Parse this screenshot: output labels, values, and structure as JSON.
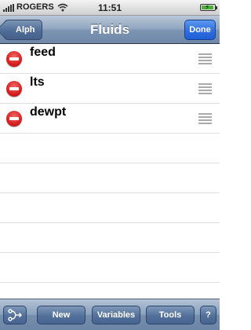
{
  "status_bar": {
    "carrier": "ROGERS",
    "time": "11:51"
  },
  "nav": {
    "back_label": "Alph",
    "title": "Fluids",
    "done_label": "Done"
  },
  "list": {
    "items": [
      {
        "label": "feed"
      },
      {
        "label": "lts"
      },
      {
        "label": "dewpt"
      }
    ]
  },
  "toolbar": {
    "branch_icon": "branch-icon",
    "new_label": "New",
    "variables_label": "Variables",
    "tools_label": "Tools",
    "help_label": "?"
  },
  "colors": {
    "nav_bar": "#8ea4bf",
    "done_button": "#2f6ee0",
    "delete_icon": "#d81f1f"
  }
}
